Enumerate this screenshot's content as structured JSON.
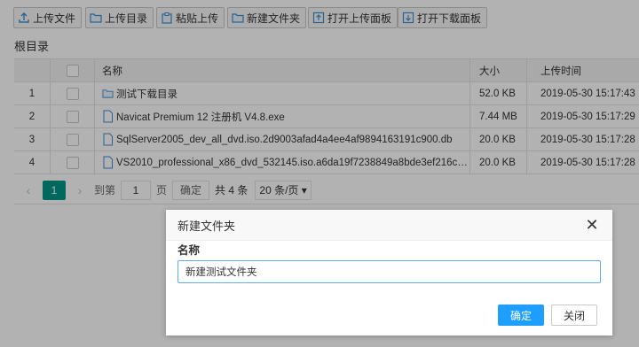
{
  "toolbar": {
    "upload_file": "上传文件",
    "upload_dir": "上传目录",
    "paste_upload": "粘贴上传",
    "new_folder": "新建文件夹",
    "open_upload_panel": "打开上传面板",
    "open_download_panel": "打开下载面板"
  },
  "breadcrumb": {
    "root": "根目录"
  },
  "table": {
    "columns": {
      "name": "名称",
      "size": "大小",
      "time": "上传时间"
    },
    "rows": [
      {
        "idx": "1",
        "name": "测试下载目录",
        "type": "folder",
        "size": "52.0 KB",
        "time": "2019-05-30 15:17:43"
      },
      {
        "idx": "2",
        "name": "Navicat Premium 12 注册机 V4.8.exe",
        "type": "file",
        "size": "7.44 MB",
        "time": "2019-05-30 15:17:29"
      },
      {
        "idx": "3",
        "name": "SqlServer2005_dev_all_dvd.iso.2d9003afad4a4ee4af9894163191c900.db",
        "type": "file",
        "size": "20.0 KB",
        "time": "2019-05-30 15:17:28"
      },
      {
        "idx": "4",
        "name": "VS2010_professional_x86_dvd_532145.iso.a6da19f7238849a8bde3ef216c26b88...",
        "type": "file",
        "size": "20.0 KB",
        "time": "2019-05-30 15:17:28"
      }
    ]
  },
  "pager": {
    "prev": "‹",
    "current": "1",
    "next": "›",
    "goto_label": "到第",
    "goto_value": "1",
    "page_unit": "页",
    "confirm": "确定",
    "total": "共 4 条",
    "page_size": "20 条/页 ▾"
  },
  "dialog": {
    "title": "新建文件夹",
    "close": "✕",
    "label": "名称",
    "input_value": "新建测试文件夹",
    "ok": "确定",
    "cancel": "关闭"
  },
  "colors": {
    "accent": "#009688",
    "primary_button": "#1e9fff",
    "input_focus_border": "#5eaee6",
    "icon_blue": "#3d8fd1"
  }
}
